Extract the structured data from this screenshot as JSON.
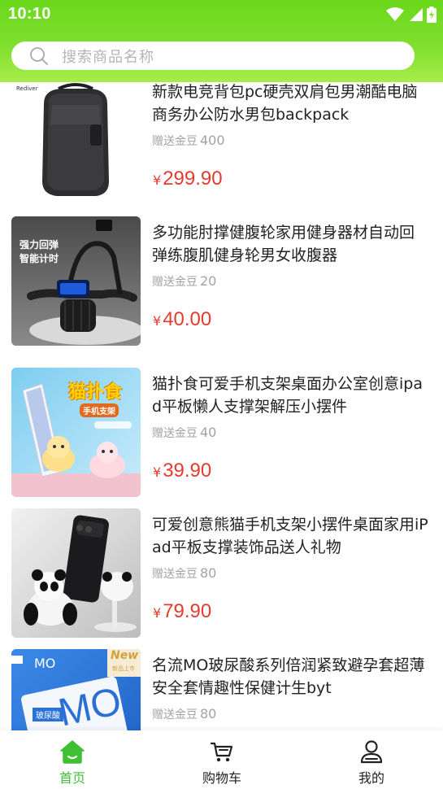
{
  "status_bar": {
    "time": "10:10",
    "icons": [
      "wifi-icon",
      "cellular-signal-icon",
      "battery-charging-icon"
    ]
  },
  "search": {
    "placeholder": "搜索商品名称",
    "icon": "search-icon"
  },
  "colors": {
    "header_gradient_top": "#6ad81a",
    "header_gradient_bottom": "#a8ec4a",
    "price": "#e63a2f",
    "nav_active": "#3fbf33",
    "muted_text": "#a3a3a3"
  },
  "products": [
    {
      "title": "新款电竞背包pc硬壳双肩包男潮酷电脑商务办公防水男包backpack",
      "bonus_label": "赠送金豆",
      "bonus_value": "400",
      "currency": "¥",
      "price": "299.90",
      "image_text": "Rediver"
    },
    {
      "title": "多功能肘撑健腹轮家用健身器材自动回弹练腹肌健身轮男女收腹器",
      "bonus_label": "赠送金豆",
      "bonus_value": "20",
      "currency": "¥",
      "price": "40.00",
      "image_text_1": "强力回弹",
      "image_text_2": "智能计时"
    },
    {
      "title": "猫扑食可爱手机支架桌面办公室创意ipad平板懒人支撑架解压小摆件",
      "bonus_label": "赠送金豆",
      "bonus_value": "40",
      "currency": "¥",
      "price": "39.90",
      "image_text_1": "猫扑食",
      "image_text_2": "手机支架"
    },
    {
      "title": "可爱创意熊猫手机支架小摆件桌面家用iPad平板支撑装饰品送人礼物",
      "bonus_label": "赠送金豆",
      "bonus_value": "80",
      "currency": "¥",
      "price": "79.90"
    },
    {
      "title": "名流MO玻尿酸系列倍润紧致避孕套超薄安全套情趣性保健计生byt",
      "bonus_label": "赠送金豆",
      "bonus_value": "80",
      "currency": "¥",
      "price": "",
      "image_text_1": "MO",
      "image_text_2": "New",
      "image_text_3": "新品上市",
      "image_text_4": "玻尿酸"
    }
  ],
  "bottom_nav": {
    "items": [
      {
        "label": "首页",
        "icon": "home-icon",
        "active": true
      },
      {
        "label": "购物车",
        "icon": "shopping-cart-icon",
        "active": false
      },
      {
        "label": "我的",
        "icon": "user-icon",
        "active": false
      }
    ]
  }
}
